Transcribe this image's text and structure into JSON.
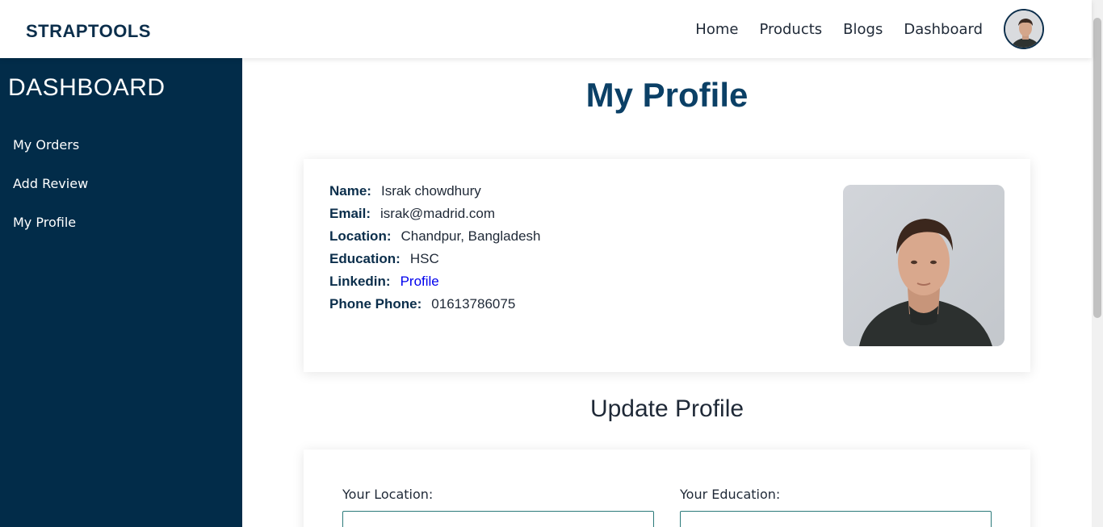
{
  "navbar": {
    "brand": "STRAPTOOLS",
    "links": [
      "Home",
      "Products",
      "Blogs",
      "Dashboard"
    ]
  },
  "sidebar": {
    "title": "DASHBOARD",
    "items": [
      "My Orders",
      "Add Review",
      "My Profile"
    ]
  },
  "profile": {
    "title": "My Profile",
    "fields": [
      {
        "label": "Name:",
        "value": "Israk chowdhury"
      },
      {
        "label": "Email:",
        "value": "israk@madrid.com"
      },
      {
        "label": "Location:",
        "value": "Chandpur, Bangladesh"
      },
      {
        "label": "Education:",
        "value": "HSC"
      },
      {
        "label": "Linkedin:",
        "value": "Profile"
      },
      {
        "label": "Phone Phone:",
        "value": "01613786075"
      }
    ]
  },
  "update_form": {
    "title": "Update Profile",
    "location_label": "Your Location:",
    "education_label": "Your Education:"
  },
  "colors": {
    "sidebar_bg": "#022c49",
    "title_color": "#0b4066",
    "link_color": "#0000ee"
  }
}
